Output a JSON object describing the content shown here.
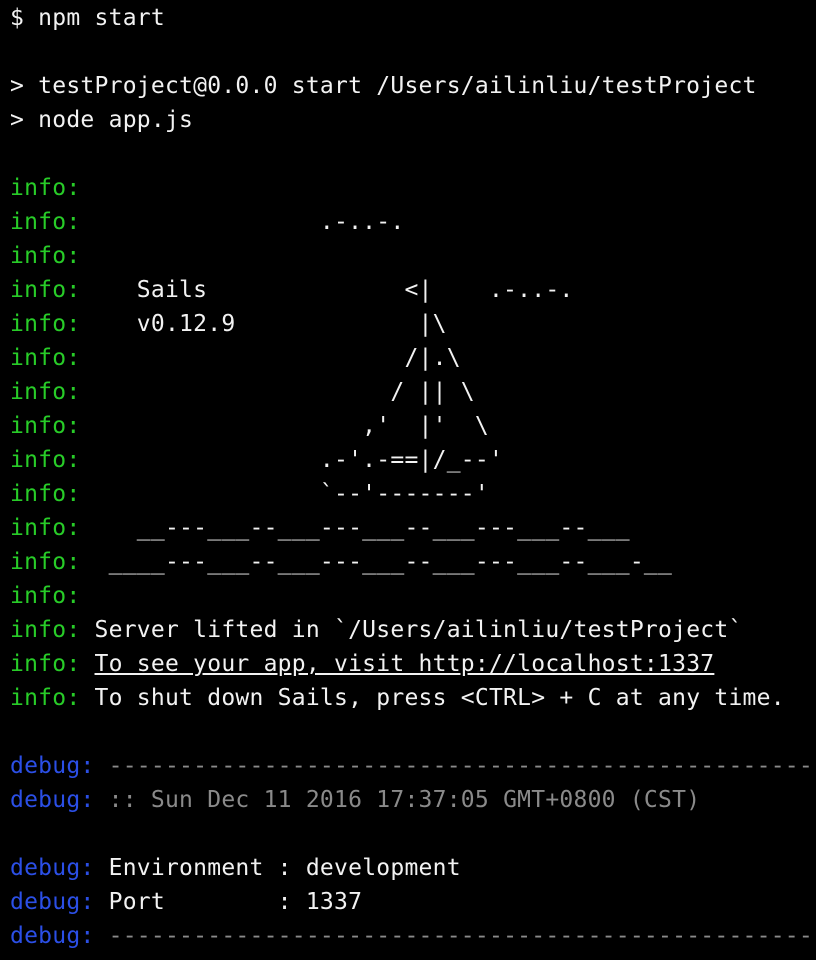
{
  "colors": {
    "background": "#000000",
    "text": "#f2f2f2",
    "info_prefix": "#28cc28",
    "debug_prefix": "#2b4fe6",
    "dim_text": "#8a8a8a"
  },
  "lines": [
    {
      "kind": "plain",
      "text": "$ npm start"
    },
    {
      "kind": "blank",
      "text": ""
    },
    {
      "kind": "plain",
      "text": "> testProject@0.0.0 start /Users/ailinliu/testProject"
    },
    {
      "kind": "plain",
      "text": "> node app.js"
    },
    {
      "kind": "blank",
      "text": ""
    },
    {
      "kind": "info",
      "prefix": "info:",
      "text": ""
    },
    {
      "kind": "info",
      "prefix": "info:",
      "text": "                .-..-."
    },
    {
      "kind": "info",
      "prefix": "info:",
      "text": ""
    },
    {
      "kind": "info",
      "prefix": "info:",
      "text": "   Sails              <|    .-..-."
    },
    {
      "kind": "info",
      "prefix": "info:",
      "text": "   v0.12.9             |\\"
    },
    {
      "kind": "info",
      "prefix": "info:",
      "text": "                      /|.\\"
    },
    {
      "kind": "info",
      "prefix": "info:",
      "text": "                     / || \\"
    },
    {
      "kind": "info",
      "prefix": "info:",
      "text": "                   ,'  |'  \\"
    },
    {
      "kind": "info",
      "prefix": "info:",
      "text": "                .-'.-==|/_--'"
    },
    {
      "kind": "info",
      "prefix": "info:",
      "text": "                `--'-------'"
    },
    {
      "kind": "info",
      "prefix": "info:",
      "text": "   __---___--___---___--___---___--___"
    },
    {
      "kind": "info",
      "prefix": "info:",
      "text": " ____---___--___---___--___---___--___-__"
    },
    {
      "kind": "info",
      "prefix": "info:",
      "text": ""
    },
    {
      "kind": "info",
      "prefix": "info:",
      "text": "Server lifted in `/Users/ailinliu/testProject`"
    },
    {
      "kind": "info-link",
      "prefix": "info:",
      "text": "To see your app, visit http://localhost:1337"
    },
    {
      "kind": "info",
      "prefix": "info:",
      "text": "To shut down Sails, press <CTRL> + C at any time."
    },
    {
      "kind": "blank",
      "text": ""
    },
    {
      "kind": "debug-dim",
      "prefix": "debug:",
      "text": "-------------------------------------------------------"
    },
    {
      "kind": "debug-dim",
      "prefix": "debug:",
      "text": ":: Sun Dec 11 2016 17:37:05 GMT+0800 (CST)"
    },
    {
      "kind": "blank",
      "text": ""
    },
    {
      "kind": "debug",
      "prefix": "debug:",
      "text": "Environment : development"
    },
    {
      "kind": "debug",
      "prefix": "debug:",
      "text": "Port        : 1337"
    },
    {
      "kind": "debug-dim",
      "prefix": "debug:",
      "text": "-------------------------------------------------------"
    }
  ]
}
